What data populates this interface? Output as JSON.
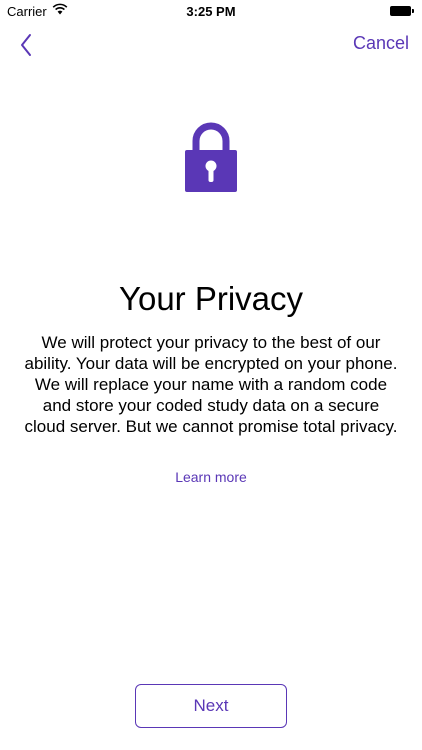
{
  "status_bar": {
    "carrier": "Carrier",
    "time": "3:25 PM",
    "wifi_icon": "wifi-icon",
    "battery_icon": "battery-icon"
  },
  "nav": {
    "back_icon": "chevron-left-icon",
    "cancel_label": "Cancel"
  },
  "content": {
    "icon": "lock-icon",
    "title": "Your Privacy",
    "body": "We will protect your privacy to the best of our ability. Your data will be encrypted on your phone. We will replace your name with a random code and store your coded study data on a secure cloud server.  But we cannot promise total privacy.",
    "learn_more_label": "Learn more"
  },
  "footer": {
    "next_label": "Next"
  },
  "colors": {
    "accent": "#5a37b6",
    "text": "#000000",
    "background": "#ffffff"
  }
}
